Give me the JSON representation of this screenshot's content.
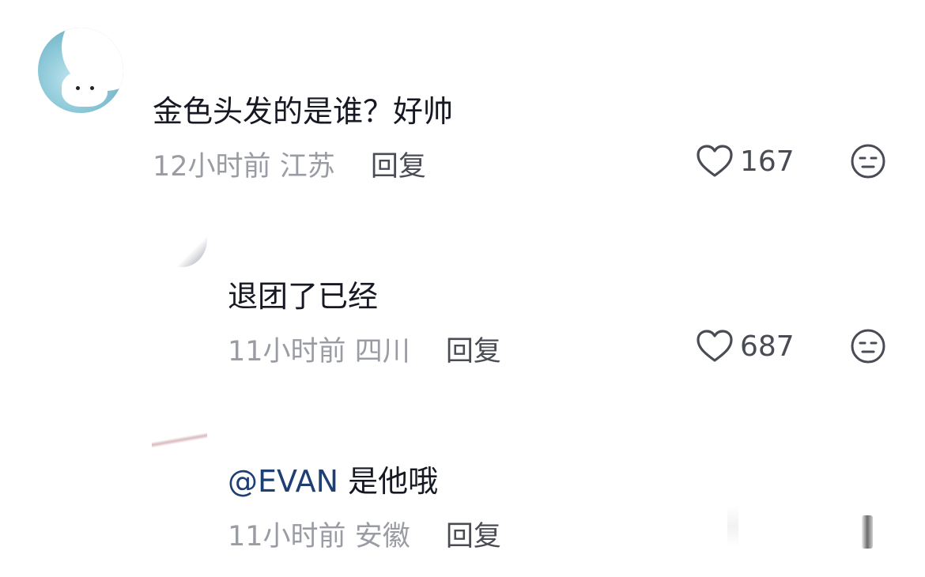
{
  "comments": [
    {
      "text": "金色头发的是谁？好帅",
      "time": "12小时前",
      "location": "江苏",
      "reply_label": "回复",
      "likes": "167",
      "avatar_icon": "cat-avatar"
    },
    {
      "text": "退团了已经",
      "time": "11小时前",
      "location": "四川",
      "reply_label": "回复",
      "likes": "687"
    },
    {
      "mention": "@EVAN",
      "text": "是他哦",
      "time": "11小时前",
      "location": "安徽",
      "reply_label": "回复"
    }
  ],
  "icons": {
    "like": "heart-outline-icon",
    "dislike": "neutral-face-icon"
  },
  "colors": {
    "text": "#161823",
    "meta": "#9a9ca3",
    "mention": "#1d3f73"
  }
}
